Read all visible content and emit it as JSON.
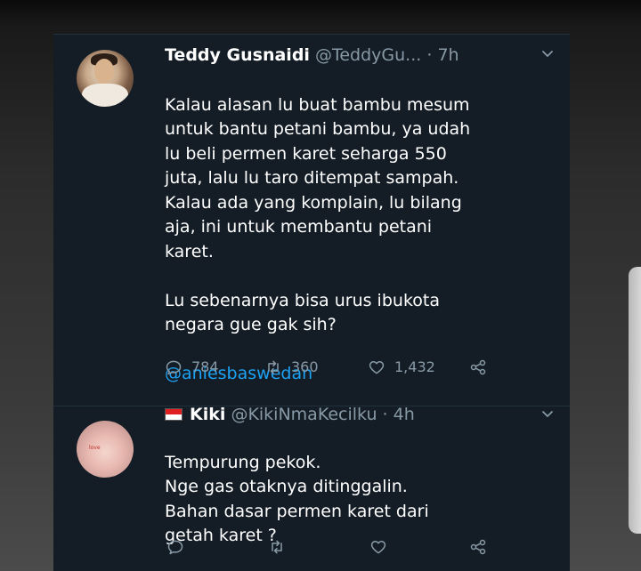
{
  "tweets": [
    {
      "name": "Teddy Gusnaidi",
      "handle": "@TeddyGu...",
      "time": "· 7h",
      "text": "Kalau alasan lu buat bambu mesum\nuntuk bantu petani bambu, ya udah\nlu beli permen karet seharga 550\njuta, lalu lu taro ditempat sampah.\nKalau ada yang komplain, lu bilang\naja, ini untuk membantu petani\nkaret.\n\nLu sebenarnya bisa urus ibukota\nnegara gue gak sih?",
      "mention": "@aniesbaswedan",
      "replies": "784",
      "retweets": "360",
      "likes": "1,432"
    },
    {
      "name": "Kiki",
      "handle": "@KikiNmaKecilku",
      "time": "· 4h",
      "text": "Tempurung pekok.\nNge gas otaknya ditinggalin.\nBahan dasar permen karet dari\ngetah karet ?",
      "replies": "",
      "retweets": "",
      "likes": ""
    }
  ],
  "icons": {
    "reply": "reply-icon",
    "retweet": "retweet-icon",
    "like": "heart-icon",
    "share": "share-icon",
    "menu": "chevron-down-icon",
    "flag": "indonesia-flag-icon"
  },
  "colors": {
    "background": "#141d26",
    "text": "#ffffff",
    "muted": "#8899a6",
    "link": "#1da1f2",
    "divider": "#22303c"
  }
}
